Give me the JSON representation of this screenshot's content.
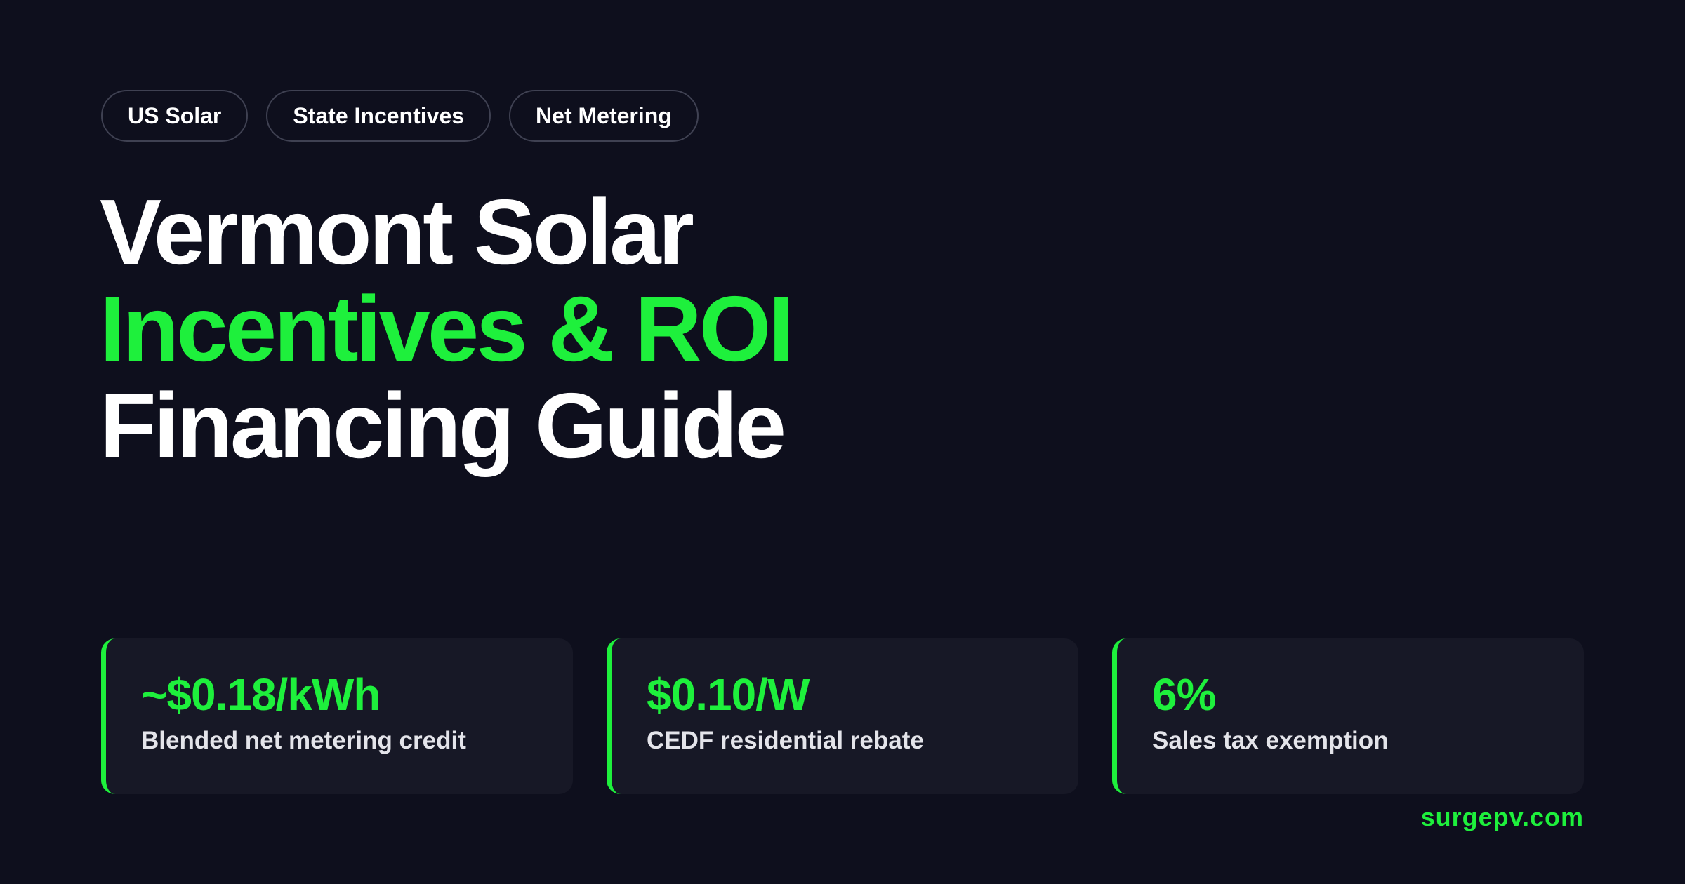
{
  "tags": [
    "US Solar",
    "State Incentives",
    "Net Metering"
  ],
  "headline": {
    "line1": "Vermont Solar",
    "line2": "Incentives & ROI",
    "line3": "Financing Guide"
  },
  "stats": [
    {
      "value": "~$0.18/kWh",
      "label": "Blended net metering credit"
    },
    {
      "value": "$0.10/W",
      "label": "CEDF residential rebate"
    },
    {
      "value": "6%",
      "label": "Sales tax exemption"
    }
  ],
  "site": "surgepv.com",
  "colors": {
    "background": "#0e0f1d",
    "accent": "#1ef03c",
    "card": "#171826",
    "tag_border": "#3f4152"
  }
}
